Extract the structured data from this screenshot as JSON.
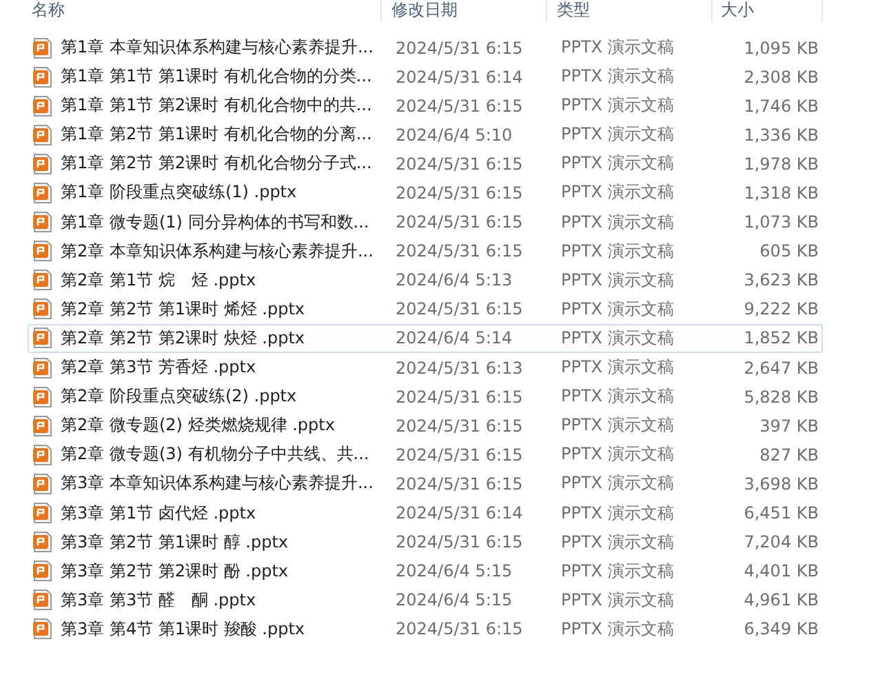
{
  "columns": [
    "名称",
    "修改日期",
    "类型",
    "大小"
  ],
  "rows": [
    {
      "name": "第1章 本章知识体系构建与核心素养提升...",
      "date": "2024/5/31 6:15",
      "type": "PPTX 演示文稿",
      "size": "1,095 KB",
      "focused": false
    },
    {
      "name": "第1章 第1节 第1课时 有机化合物的分类...",
      "date": "2024/5/31 6:14",
      "type": "PPTX 演示文稿",
      "size": "2,308 KB",
      "focused": false
    },
    {
      "name": "第1章 第1节 第2课时 有机化合物中的共...",
      "date": "2024/5/31 6:15",
      "type": "PPTX 演示文稿",
      "size": "1,746 KB",
      "focused": false
    },
    {
      "name": "第1章 第2节 第1课时 有机化合物的分离...",
      "date": "2024/6/4 5:10",
      "type": "PPTX 演示文稿",
      "size": "1,336 KB",
      "focused": false
    },
    {
      "name": "第1章 第2节 第2课时 有机化合物分子式...",
      "date": "2024/5/31 6:15",
      "type": "PPTX 演示文稿",
      "size": "1,978 KB",
      "focused": false
    },
    {
      "name": "第1章 阶段重点突破练(1)  .pptx",
      "date": "2024/5/31 6:15",
      "type": "PPTX 演示文稿",
      "size": "1,318 KB",
      "focused": false
    },
    {
      "name": "第1章 微专题(1) 同分异构体的书写和数...",
      "date": "2024/5/31 6:15",
      "type": "PPTX 演示文稿",
      "size": "1,073 KB",
      "focused": false
    },
    {
      "name": "第2章 本章知识体系构建与核心素养提升...",
      "date": "2024/5/31 6:15",
      "type": "PPTX 演示文稿",
      "size": "605 KB",
      "focused": false
    },
    {
      "name": "第2章 第1节 烷　烃  .pptx",
      "date": "2024/6/4 5:13",
      "type": "PPTX 演示文稿",
      "size": "3,623 KB",
      "focused": false
    },
    {
      "name": "第2章 第2节 第1课时 烯烃  .pptx",
      "date": "2024/5/31 6:15",
      "type": "PPTX 演示文稿",
      "size": "9,222 KB",
      "focused": false
    },
    {
      "name": "第2章 第2节 第2课时 炔烃  .pptx",
      "date": "2024/6/4 5:14",
      "type": "PPTX 演示文稿",
      "size": "1,852 KB",
      "focused": true
    },
    {
      "name": "第2章 第3节 芳香烃  .pptx",
      "date": "2024/5/31 6:13",
      "type": "PPTX 演示文稿",
      "size": "2,647 KB",
      "focused": false
    },
    {
      "name": "第2章 阶段重点突破练(2)  .pptx",
      "date": "2024/5/31 6:15",
      "type": "PPTX 演示文稿",
      "size": "5,828 KB",
      "focused": false
    },
    {
      "name": "第2章 微专题(2) 烃类燃烧规律  .pptx",
      "date": "2024/5/31 6:15",
      "type": "PPTX 演示文稿",
      "size": "397 KB",
      "focused": false
    },
    {
      "name": "第2章 微专题(3) 有机物分子中共线、共...",
      "date": "2024/5/31 6:15",
      "type": "PPTX 演示文稿",
      "size": "827 KB",
      "focused": false
    },
    {
      "name": "第3章 本章知识体系构建与核心素养提升...",
      "date": "2024/5/31 6:15",
      "type": "PPTX 演示文稿",
      "size": "3,698 KB",
      "focused": false
    },
    {
      "name": "第3章 第1节 卤代烃  .pptx",
      "date": "2024/5/31 6:14",
      "type": "PPTX 演示文稿",
      "size": "6,451 KB",
      "focused": false
    },
    {
      "name": "第3章 第2节 第1课时 醇  .pptx",
      "date": "2024/5/31 6:15",
      "type": "PPTX 演示文稿",
      "size": "7,204 KB",
      "focused": false
    },
    {
      "name": "第3章 第2节 第2课时 酚  .pptx",
      "date": "2024/6/4 5:15",
      "type": "PPTX 演示文稿",
      "size": "4,401 KB",
      "focused": false
    },
    {
      "name": "第3章 第3节 醛　酮  .pptx",
      "date": "2024/6/4 5:15",
      "type": "PPTX 演示文稿",
      "size": "4,961 KB",
      "focused": false
    },
    {
      "name": "第3章 第4节 第1课时 羧酸  .pptx",
      "date": "2024/5/31 6:15",
      "type": "PPTX 演示文稿",
      "size": "6,349 KB",
      "focused": false
    }
  ]
}
